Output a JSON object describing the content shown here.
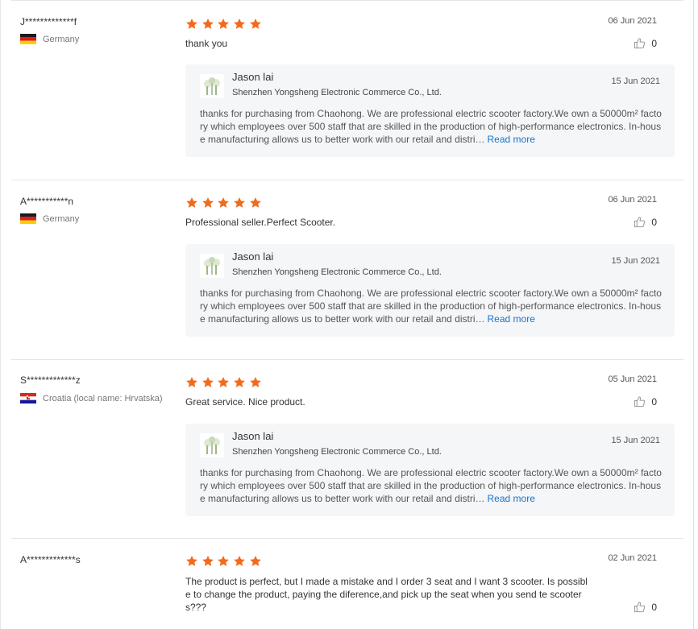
{
  "colors": {
    "star": "#f26b1d",
    "link": "#1a73c8",
    "reply_bg": "#f5f6f8"
  },
  "icons": {
    "star": "star-icon",
    "thumb": "thumbs-up-icon"
  },
  "reviews": [
    {
      "buyer": "J*************f",
      "country": "Germany",
      "flag": "germany",
      "rating": 5,
      "date": "06 Jun 2021",
      "text": "thank you",
      "likes": "0",
      "reply": {
        "name": "Jason lai",
        "company": "Shenzhen Yongsheng Electronic Commerce Co., Ltd.",
        "date": "15 Jun 2021",
        "text": "thanks for purchasing from Chaohong. We are professional electric scooter factory.We own a 50000m² factory which employees over 500 staff that are skilled in the production of high-performance electronics. In-house manufacturing allows us to better work with our retail and distri…",
        "read_more": "Read more"
      }
    },
    {
      "buyer": "A***********n",
      "country": "Germany",
      "flag": "germany",
      "rating": 5,
      "date": "06 Jun 2021",
      "text": "Professional seller.Perfect Scooter.",
      "likes": "0",
      "reply": {
        "name": "Jason lai",
        "company": "Shenzhen Yongsheng Electronic Commerce Co., Ltd.",
        "date": "15 Jun 2021",
        "text": "thanks for purchasing from Chaohong. We are professional electric scooter factory.We own a 50000m² factory which employees over 500 staff that are skilled in the production of high-performance electronics. In-house manufacturing allows us to better work with our retail and distri…",
        "read_more": "Read more"
      }
    },
    {
      "buyer": "S*************z",
      "country": "Croatia (local name: Hrvatska)",
      "flag": "croatia",
      "rating": 5,
      "date": "05 Jun 2021",
      "text": "Great service. Nice product.",
      "likes": "0",
      "reply": {
        "name": "Jason lai",
        "company": "Shenzhen Yongsheng Electronic Commerce Co., Ltd.",
        "date": "15 Jun 2021",
        "text": "thanks for purchasing from Chaohong. We are professional electric scooter factory.We own a 50000m² factory which employees over 500 staff that are skilled in the production of high-performance electronics. In-house manufacturing allows us to better work with our retail and distri…",
        "read_more": "Read more"
      }
    },
    {
      "buyer": "A*************s",
      "rating": 5,
      "date": "02 Jun 2021",
      "text": "The product is perfect, but I made a mistake and I order 3 seat and I want 3 scooter. Is possible to change the product, paying the diference,and pick up the seat when you send te scooters???",
      "likes": "0"
    }
  ]
}
